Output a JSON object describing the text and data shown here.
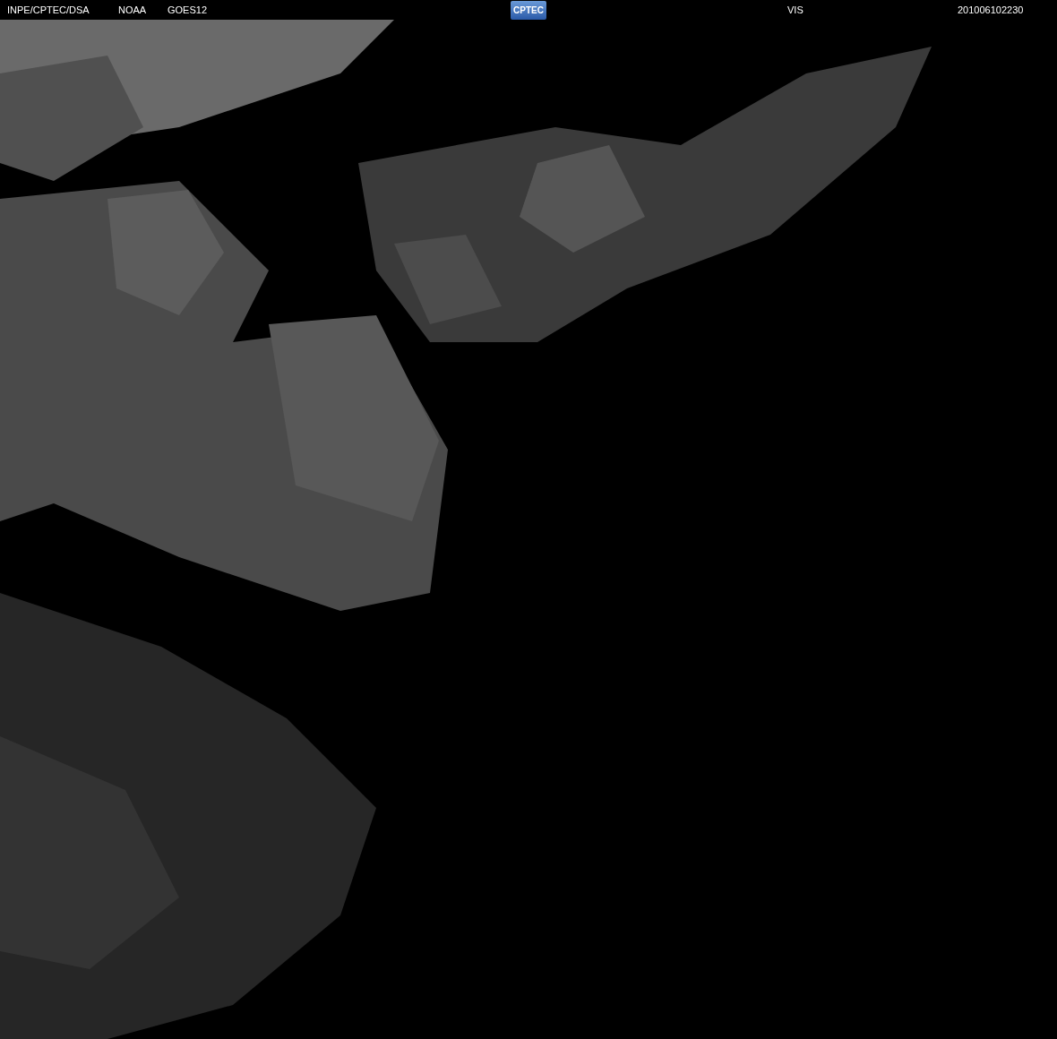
{
  "header": {
    "left": [
      "INPE/CPTEC/DSA",
      "NOAA",
      "GOES12"
    ],
    "logo": "CPTEC",
    "channel": "VIS",
    "timestamp": "201006102230"
  }
}
